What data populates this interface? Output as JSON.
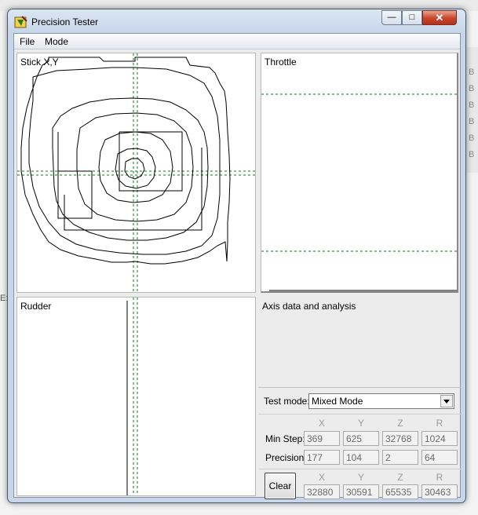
{
  "window": {
    "title": "Precision Tester"
  },
  "menu": [
    {
      "label": "File"
    },
    {
      "label": "Mode"
    }
  ],
  "panels": {
    "stick": {
      "label": "Stick X,Y"
    },
    "throttle": {
      "label": "Throttle"
    },
    "rudder": {
      "label": "Rudder"
    },
    "analysis": {
      "label": "Axis data and analysis"
    }
  },
  "test_mode": {
    "label": "Test mode:",
    "value": "Mixed Mode"
  },
  "stats": {
    "columns": [
      "X",
      "Y",
      "Z",
      "R"
    ],
    "min_step": {
      "label": "Min Step:",
      "values": [
        "369",
        "625",
        "32768",
        "1024"
      ]
    },
    "precision": {
      "label": "Precision:",
      "values": [
        "177",
        "104",
        "2",
        "64"
      ]
    }
  },
  "current": {
    "columns": [
      "X",
      "Y",
      "Z",
      "R"
    ],
    "clear_label": "Clear",
    "values": [
      "32880",
      "30591",
      "65535",
      "30463"
    ]
  },
  "background": {
    "letters": [
      "B",
      "B",
      "B",
      "B",
      "B",
      "B"
    ],
    "left_mark": "E:"
  },
  "colors": {
    "guide_line": "#0a7a1e",
    "trace": "#000000",
    "close_button": "#c6452b"
  }
}
